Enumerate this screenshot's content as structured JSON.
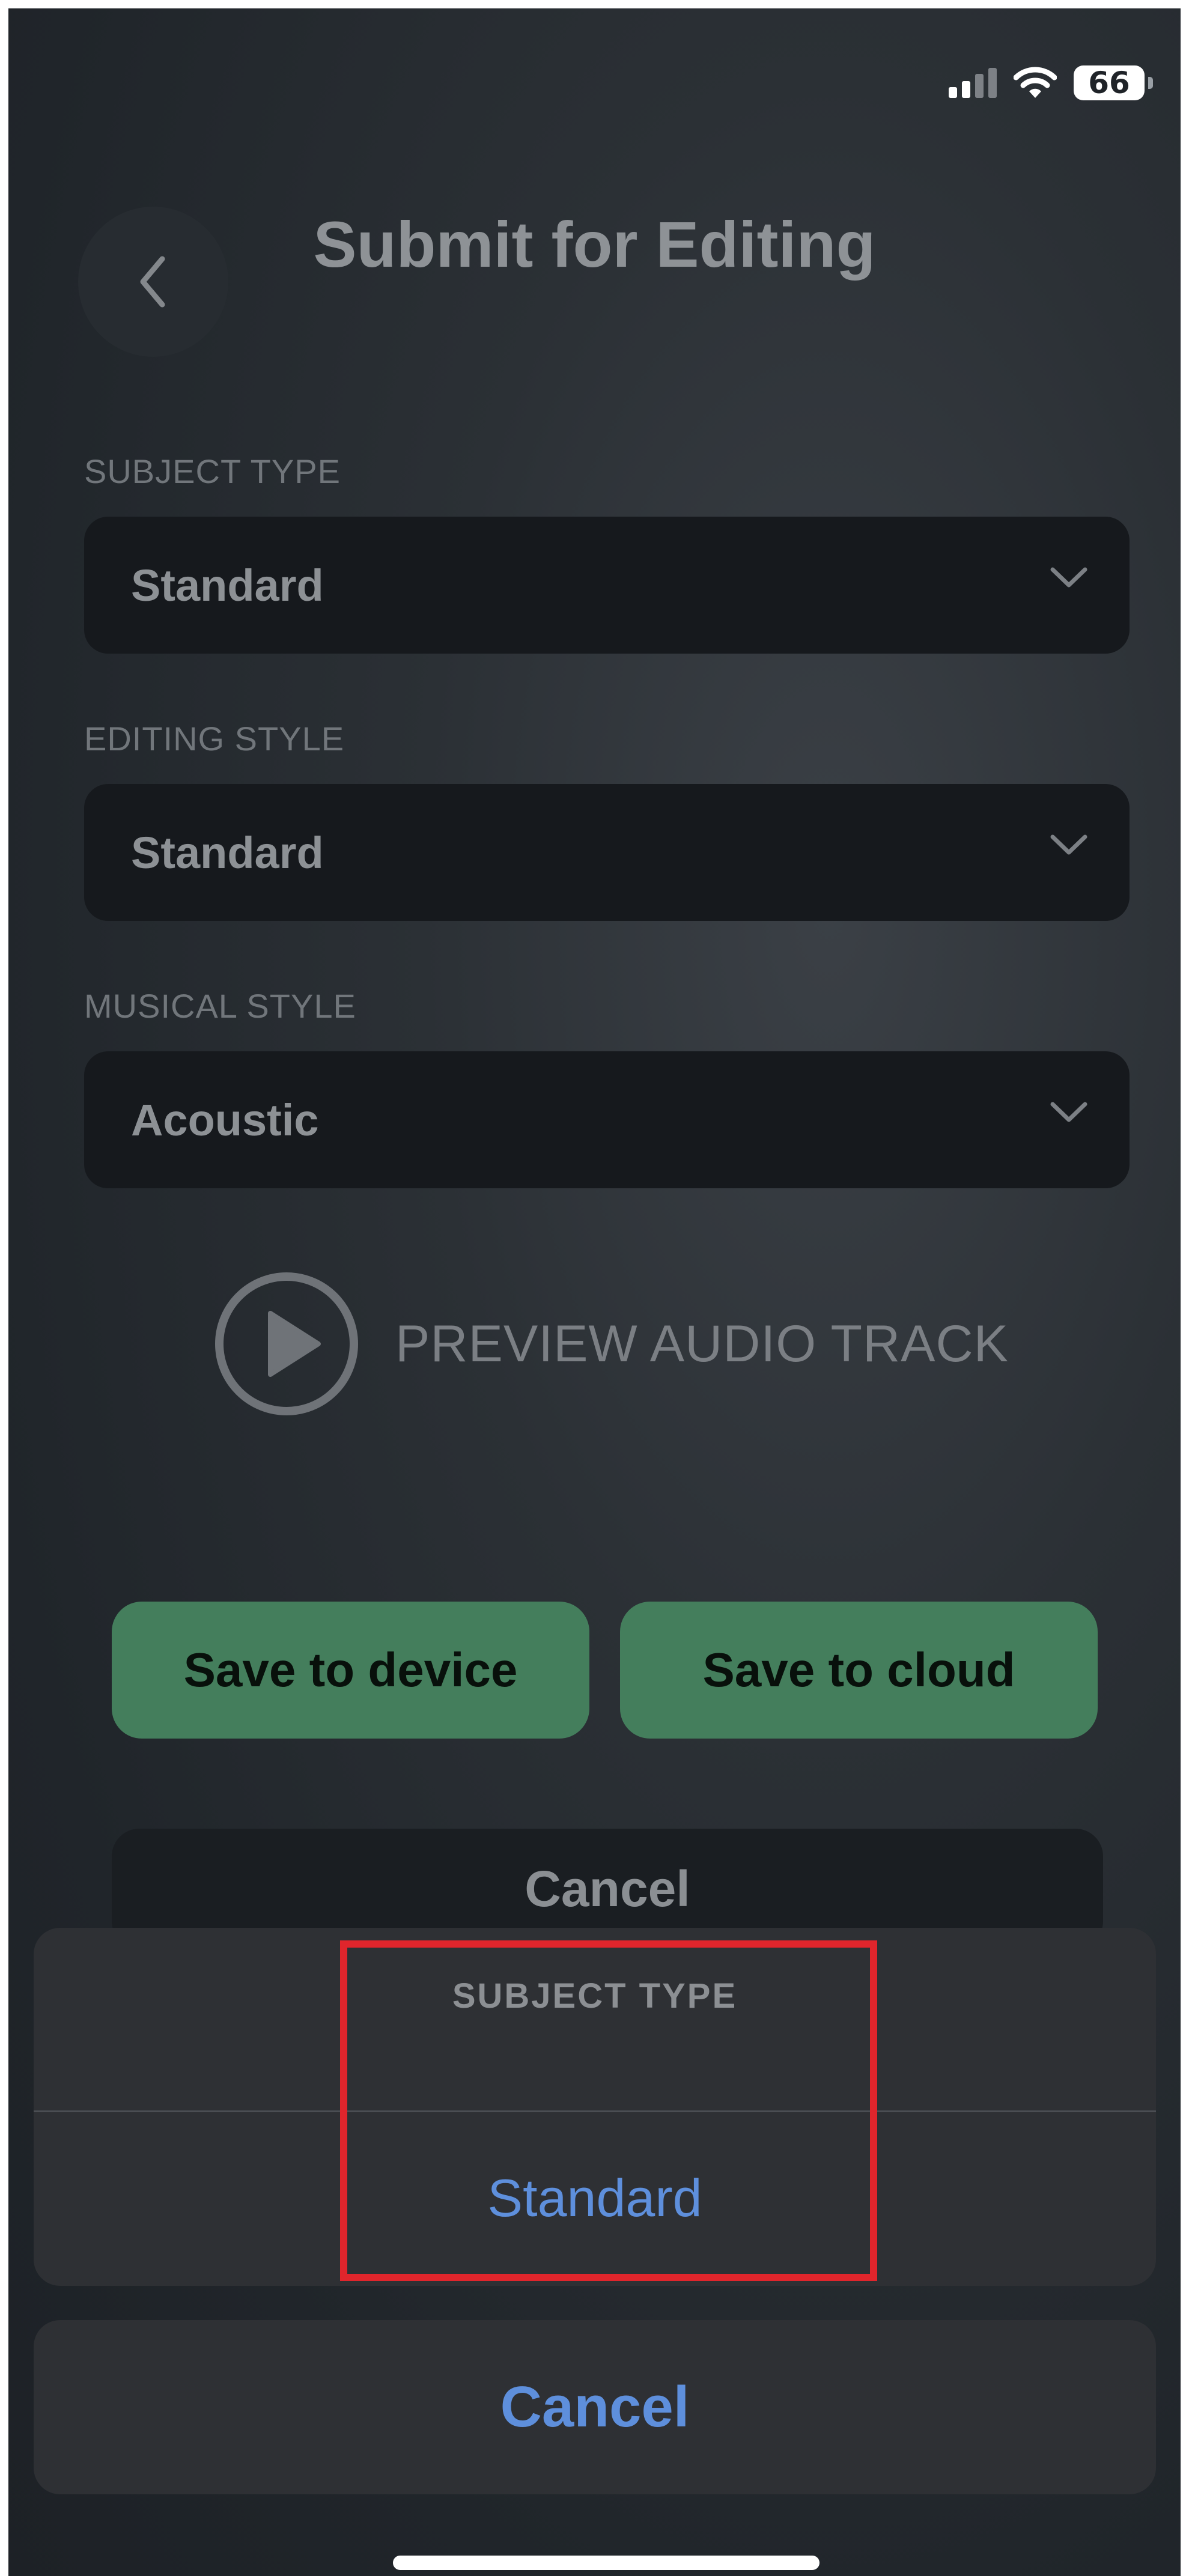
{
  "status_bar": {
    "battery": "66"
  },
  "header": {
    "title": "Submit for Editing"
  },
  "form": {
    "subject_type": {
      "label": "SUBJECT TYPE",
      "value": "Standard"
    },
    "editing_style": {
      "label": "EDITING STYLE",
      "value": "Standard"
    },
    "musical_style": {
      "label": "MUSICAL STYLE",
      "value": "Acoustic"
    }
  },
  "preview": {
    "label": "PREVIEW AUDIO TRACK"
  },
  "actions": {
    "save_device": "Save to device",
    "save_cloud": "Save to cloud",
    "cancel": "Cancel"
  },
  "action_sheet": {
    "title": "SUBJECT TYPE",
    "options": [
      "Standard"
    ],
    "cancel": "Cancel"
  },
  "colors": {
    "accent_green": "#447e5c",
    "ios_blue": "#5e8fdc",
    "highlight_red": "#e0252c"
  }
}
